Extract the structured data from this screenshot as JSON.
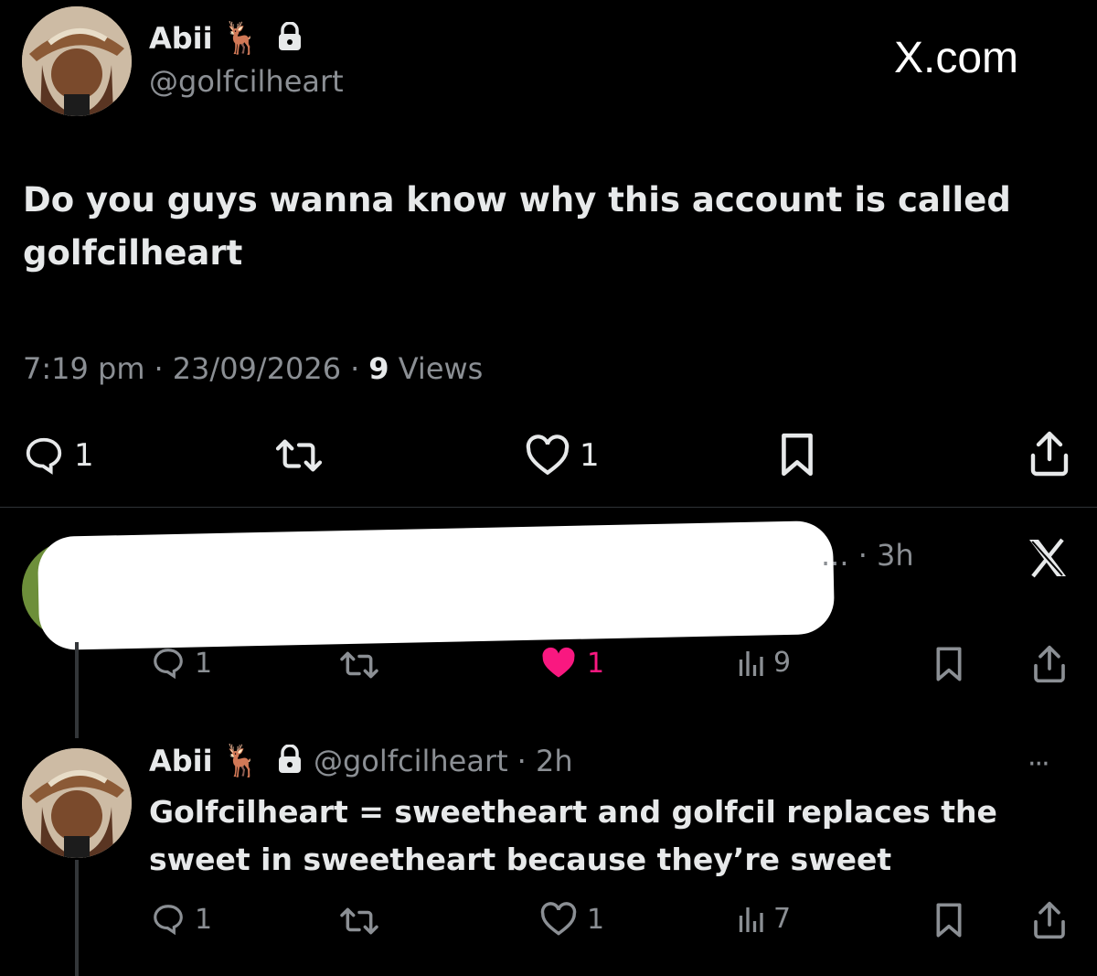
{
  "tweet": {
    "name": "Abii",
    "name_emoji": "🦌",
    "handle": "@golfcilheart",
    "site_label": "X.com",
    "text": "Do you guys wanna know why this account is called golfcilheart",
    "time": "7:19 pm",
    "date": "23/09/2026",
    "views_count": "9",
    "views_label": "Views",
    "dot": "·",
    "stats": {
      "replies": "1",
      "likes": "1"
    }
  },
  "reply1": {
    "meta": "... · 3h",
    "close_label": "X",
    "stats": {
      "replies": "1",
      "likes": "1",
      "views": "9"
    },
    "like_color": "#f91880"
  },
  "reply2": {
    "name": "Abii",
    "name_emoji": "🦌",
    "handle": "@golfcilheart",
    "time": "· 2h",
    "more_label": "···",
    "text": "Golfcilheart = sweetheart and golfcil replaces the sweet in sweetheart because they’re sweet",
    "stats": {
      "replies": "1",
      "likes": "1",
      "views": "7"
    }
  },
  "icons": [
    "avatar",
    "deer-emoji",
    "lock-icon",
    "reply-icon",
    "retweet-icon",
    "heart-icon",
    "bookmark-icon",
    "share-icon",
    "views-icon",
    "close-icon",
    "more-icon"
  ]
}
